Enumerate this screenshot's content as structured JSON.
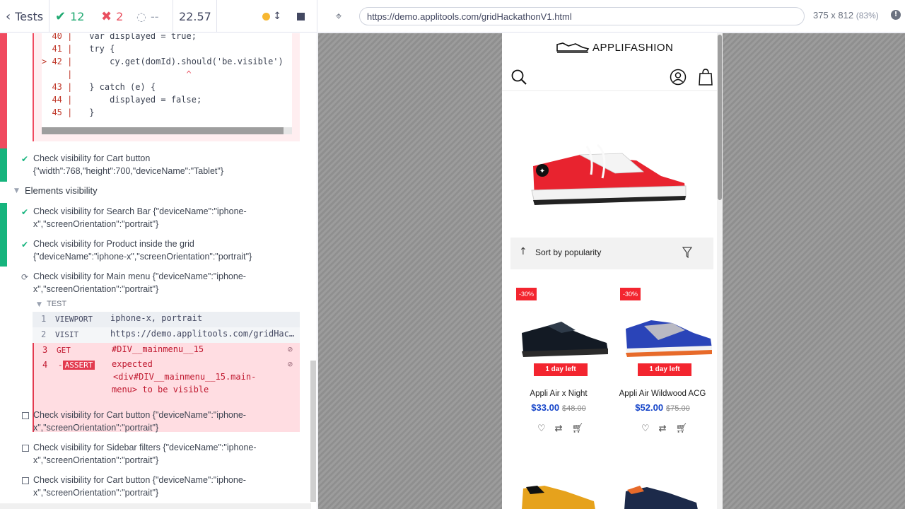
{
  "reporter": {
    "tests_label": "Tests",
    "passed": "12",
    "failed": "2",
    "pending": "--",
    "duration": "22.57"
  },
  "code": {
    "lines": [
      {
        "ln": "  40 |",
        "text": " var displayed = true;"
      },
      {
        "ln": "  41 |",
        "text": " try {"
      },
      {
        "ln": "> 42 |",
        "text": "     cy.get(domId).should('be.visible')"
      },
      {
        "ln": "     |",
        "text": "                    ^"
      },
      {
        "ln": "  43 |",
        "text": " } catch (e) {"
      },
      {
        "ln": "  44 |",
        "text": "     displayed = false;"
      },
      {
        "ln": "  45 |",
        "text": " }"
      }
    ]
  },
  "tests": {
    "cart_tablet_1": "Check visibility for Cart button",
    "cart_tablet_2": "{\"width\":768,\"height\":700,\"deviceName\":\"Tablet\"}",
    "suite_elements": "Elements visibility",
    "search_1": "Check visibility for Search Bar {\"deviceName\":\"iphone-",
    "search_2": "x\",\"screenOrientation\":\"portrait\"}",
    "product_1": "Check visibility for Product inside the grid",
    "product_2": "{\"deviceName\":\"iphone-x\",\"screenOrientation\":\"portrait\"}",
    "mainmenu_1": "Check visibility for Main menu {\"deviceName\":\"iphone-",
    "mainmenu_2": "x\",\"screenOrientation\":\"portrait\"}",
    "cart_1": "Check visibility for Cart button {\"deviceName\":\"iphone-",
    "cart_2": "x\",\"screenOrientation\":\"portrait\"}",
    "sidebar_1": "Check visibility for Sidebar filters {\"deviceName\":\"iphone-",
    "sidebar_2": "x\",\"screenOrientation\":\"portrait\"}",
    "cart2_1": "Check visibility for Cart button {\"deviceName\":\"iphone-",
    "cart2_2": "x\",\"screenOrientation\":\"portrait\"}"
  },
  "commands": {
    "header": "TEST",
    "rows": [
      {
        "num": "1",
        "name": "VIEWPORT",
        "msg": "iphone-x, portrait"
      },
      {
        "num": "2",
        "name": "VISIT",
        "msg": "https://demo.applitools.com/gridHac…"
      },
      {
        "num": "3",
        "name": "GET",
        "msg": "#DIV__mainmenu__15"
      },
      {
        "num": "4",
        "name": "ASSERT",
        "msg1": "expected",
        "msg2": "<div#DIV__mainmenu__15.main-",
        "msg3": "menu> to be visible"
      }
    ]
  },
  "browser": {
    "url": "https://demo.applitools.com/gridHackathonV1.html",
    "size": "375 x 812",
    "zoom": "(83%)"
  },
  "site": {
    "brand": "APPLIFASHION",
    "sort_label": "Sort by popularity",
    "products": [
      {
        "badge": "-30%",
        "timer": "1 day left",
        "name": "Appli Air x Night",
        "price": "$33.00",
        "old_price": "$48.00"
      },
      {
        "badge": "-30%",
        "timer": "1 day left",
        "name": "Appli Air Wildwood ACG",
        "price": "$52.00",
        "old_price": "$75.00"
      }
    ]
  },
  "colors": {
    "pass": "#16b47d",
    "fail": "#f04a5f",
    "accent_price": "#1645c9",
    "sale_red": "#f3252f"
  }
}
